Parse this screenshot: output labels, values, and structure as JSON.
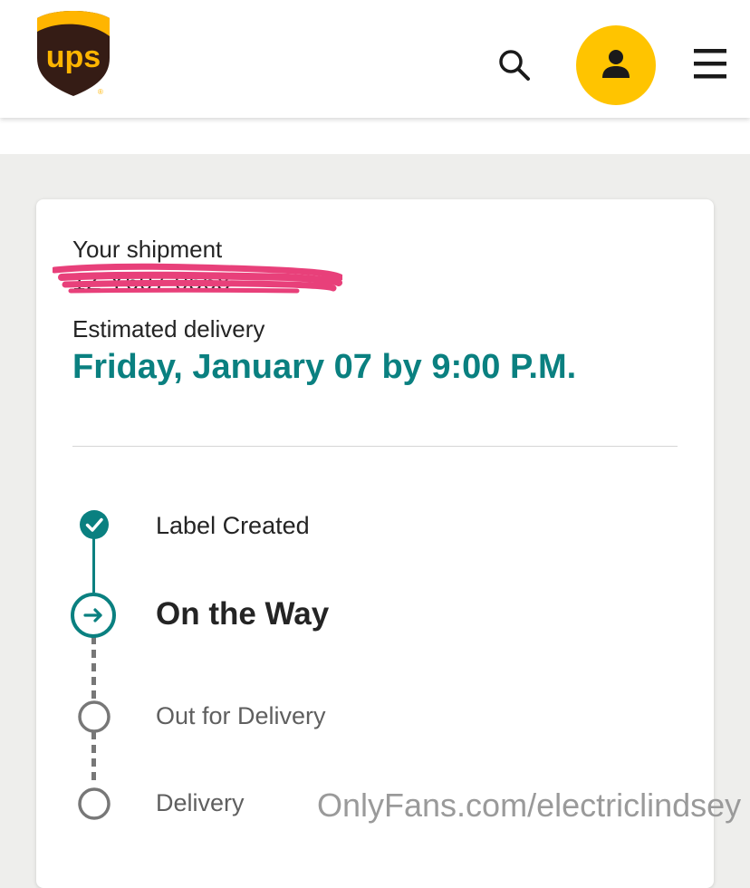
{
  "header": {
    "logo_text": "ups",
    "search_icon": "search-icon",
    "account_icon": "user-icon",
    "menu_icon": "hamburger-menu-icon",
    "brand_colors": {
      "brown": "#351c15",
      "gold": "#ffb500",
      "account_button": "#ffc400"
    }
  },
  "shipment": {
    "title": "Your shipment",
    "tracking_number_visible": "1Z          Y607   0568",
    "estimated_label": "Estimated delivery",
    "estimated_date": "Friday, January 07 by 9:00 P.M.",
    "accent_color": "#0a8080"
  },
  "progress": {
    "steps": [
      {
        "label": "Label Created",
        "status": "completed",
        "icon": "check-circle-icon"
      },
      {
        "label": "On the Way",
        "status": "current",
        "icon": "arrow-right-circle-icon"
      },
      {
        "label": "Out for Delivery",
        "status": "upcoming",
        "icon": "empty-circle-icon"
      },
      {
        "label": "Delivery",
        "status": "upcoming",
        "icon": "empty-circle-icon"
      }
    ]
  },
  "watermark": {
    "text": "OnlyFans.com/electriclindsey"
  }
}
